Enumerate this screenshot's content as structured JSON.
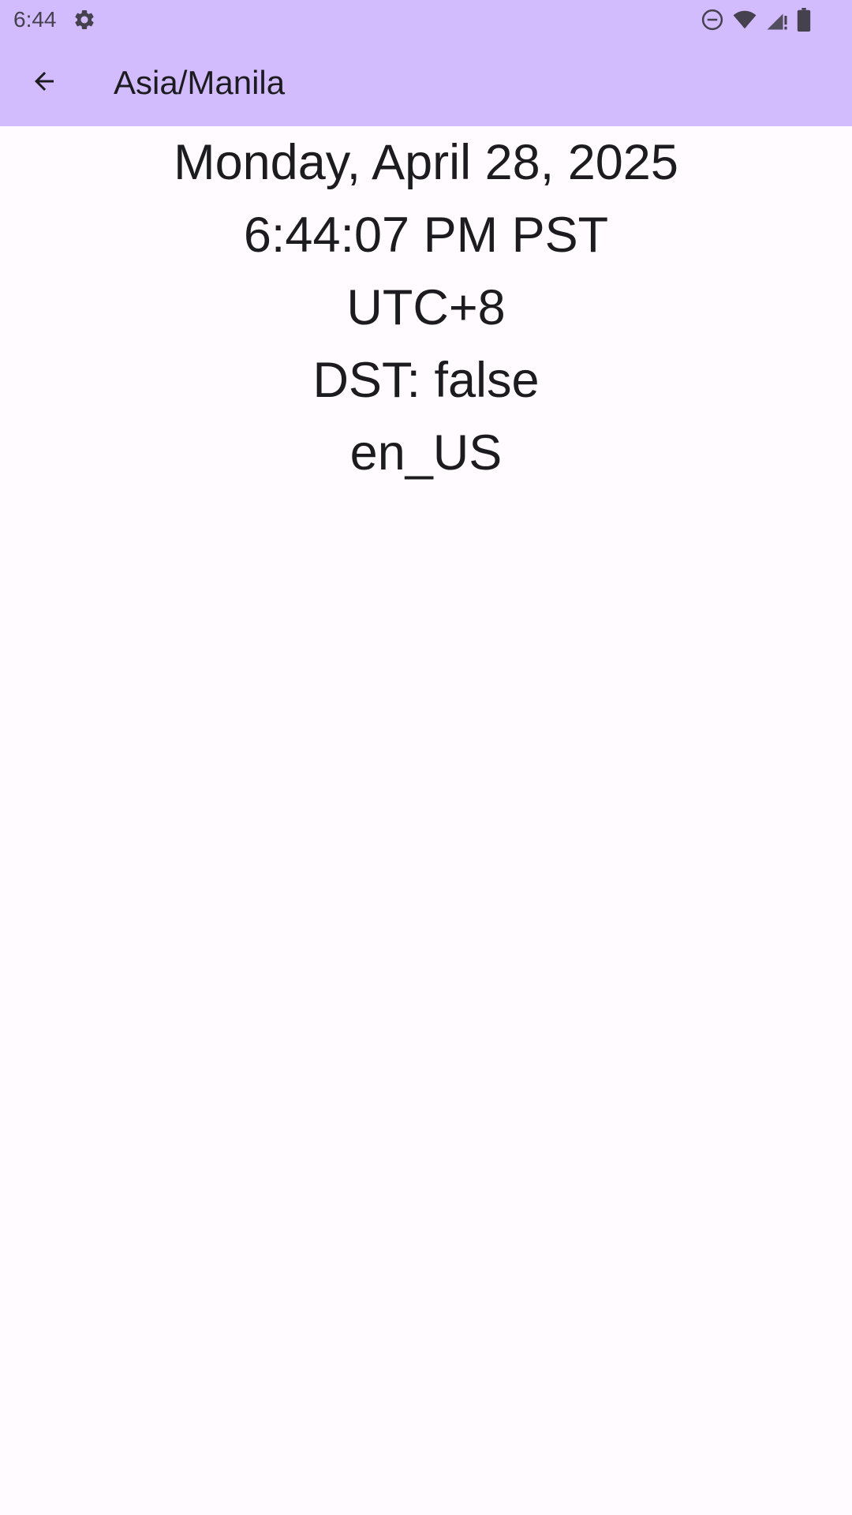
{
  "status_bar": {
    "time": "6:44",
    "icons": [
      "gear-icon",
      "do-not-disturb-icon",
      "wifi-icon",
      "cell-signal-icon",
      "battery-icon"
    ]
  },
  "app_bar": {
    "title": "Asia/Manila",
    "back_icon": "arrow-back-icon",
    "background_color": "#d2bcfd"
  },
  "timezone_info": {
    "date": "Monday, April 28, 2025",
    "time": "6:44:07 PM PST",
    "utc_offset": "UTC+8",
    "dst": "DST: false",
    "locale": "en_US"
  },
  "colors": {
    "background": "#fffbfe",
    "text": "#1c1b1f",
    "status_icons": "#45414f"
  }
}
